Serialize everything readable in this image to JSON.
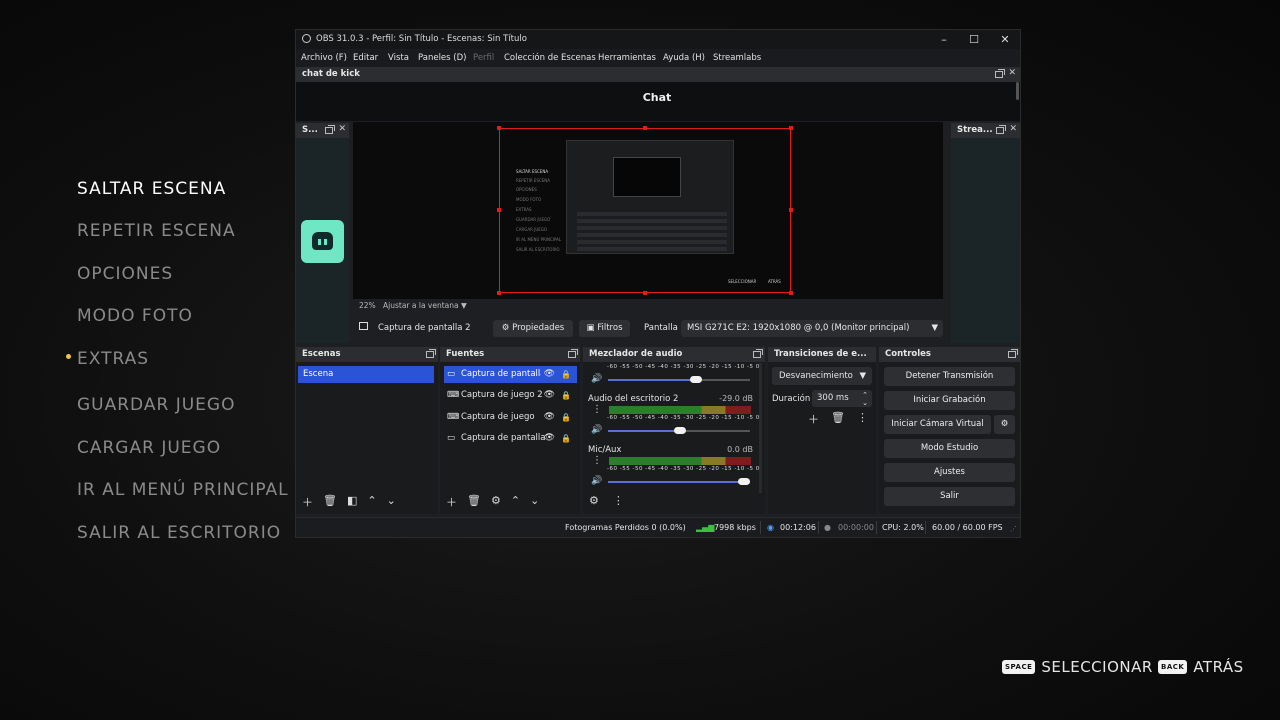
{
  "game_menu": {
    "items": [
      "SALTAR ESCENA",
      "REPETIR ESCENA",
      "OPCIONES",
      "MODO FOTO",
      "EXTRAS",
      "GUARDAR JUEGO",
      "CARGAR JUEGO",
      "IR AL MENÚ PRINCIPAL",
      "SALIR AL ESCRITORIO"
    ],
    "active_index": 0,
    "marked_index": 4
  },
  "hints": {
    "select_key": "SPACE",
    "select_label": "SELECCIONAR",
    "back_key": "BACK",
    "back_label": "ATRÁS"
  },
  "obs": {
    "title": "OBS 31.0.3 - Perfil: Sin Título - Escenas: Sin Título",
    "menu": [
      "Archivo (F)",
      "Editar",
      "Vista",
      "Paneles (D)",
      "Perfil",
      "Colección de Escenas",
      "Herramientas",
      "Ayuda (H)",
      "Streamlabs"
    ],
    "chat_dock_title": "chat de kick",
    "chat_title": "Chat",
    "left_dock_title": "S...",
    "right_dock_title": "Strea...",
    "preview": {
      "zoom": "22%",
      "fit_label": "Ajustar a la ventana",
      "mini_menu": [
        "SALTAR ESCENA",
        "REPETIR ESCENA",
        "OPCIONES",
        "MODO FOTO",
        "EXTRAS",
        "GUARDAR JUEGO",
        "CARGAR JUEGO",
        "IR AL MENÚ PRINCIPAL",
        "SALIR AL ESCRITORIO"
      ],
      "mini_hint_select": "SELECCIONAR",
      "mini_hint_back": "ATRÁS"
    },
    "source_bar": {
      "source_name": "Captura de pantalla 2",
      "properties": "Propiedades",
      "filters": "Filtros",
      "screen_label": "Pantalla",
      "screen_value": "MSI G271C E2: 1920x1080 @ 0,0 (Monitor principal)"
    },
    "scenes": {
      "title": "Escenas",
      "items": [
        "Escena"
      ]
    },
    "sources": {
      "title": "Fuentes",
      "items": [
        "Captura de pantalla 2",
        "Captura de juego 2",
        "Captura de juego",
        "Captura de pantalla"
      ]
    },
    "mixer": {
      "title": "Mezclador de audio",
      "scale": "-60 -55 -50 -45 -40 -35 -30 -25 -20 -15 -10 -5 0",
      "channels": [
        {
          "name": "",
          "db": "",
          "level": 0.62
        },
        {
          "name": "Audio del escritorio 2",
          "db": "-29.0 dB",
          "level": 0.51
        },
        {
          "name": "Mic/Aux",
          "db": "0.0 dB",
          "level": 1.0
        }
      ]
    },
    "transitions": {
      "title": "Transiciones de e...",
      "type": "Desvanecimiento",
      "duration_label": "Duración",
      "duration_value": "300 ms"
    },
    "controls": {
      "title": "Controles",
      "buttons": [
        "Detener Transmisión",
        "Iniciar Grabación",
        "Iniciar Cámara Virtual",
        "Modo Estudio",
        "Ajustes",
        "Salir"
      ]
    },
    "status": {
      "dropped": "Fotogramas Perdidos 0 (0.0%)",
      "bitrate": "7998 kbps",
      "stream_time": "00:12:06",
      "rec_time": "00:00:00",
      "cpu": "CPU: 2.0%",
      "fps": "60.00 / 60.00 FPS"
    },
    "colors": {
      "accent": "#2a53d6",
      "kick_green": "#53fc18",
      "preview_border": "#e01c1c"
    }
  }
}
